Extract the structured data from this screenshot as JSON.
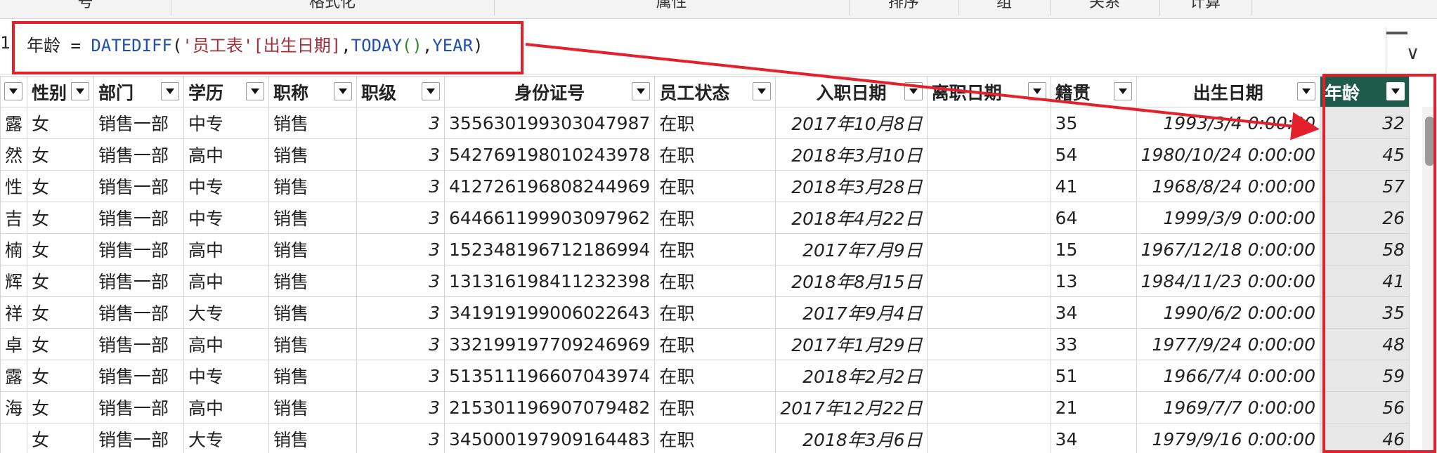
{
  "ribbon": {
    "cells": [
      "号",
      "格式化",
      "属性",
      "排序",
      "组",
      "关系",
      "计算"
    ]
  },
  "formula": {
    "line_number": "1",
    "column_name": "年龄",
    "equals": " = ",
    "fn_datediff": "DATEDIFF",
    "open_paren": "(",
    "table_ref": "'员工表'",
    "col_ref": "[出生日期]",
    "comma1": ",",
    "fn_today": "TODAY",
    "today_parens": "()",
    "comma2": ",",
    "fn_year": "YEAR",
    "close_paren": ")"
  },
  "table": {
    "headers": [
      "",
      "性别",
      "部门",
      "学历",
      "职称",
      "职级",
      "身份证号",
      "员工状态",
      "入职日期",
      "离职日期",
      "籍贯",
      "出生日期",
      "年龄"
    ],
    "rows": [
      [
        "露",
        "女",
        "销售一部",
        "中专",
        "销售",
        "3",
        "355630199303047987",
        "在职",
        "2017年10月8日",
        "",
        "35",
        "1993/3/4 0:00:00",
        "32"
      ],
      [
        "然",
        "女",
        "销售一部",
        "高中",
        "销售",
        "3",
        "542769198010243978",
        "在职",
        "2018年3月10日",
        "",
        "54",
        "1980/10/24 0:00:00",
        "45"
      ],
      [
        "性",
        "女",
        "销售一部",
        "中专",
        "销售",
        "3",
        "412726196808244969",
        "在职",
        "2018年3月28日",
        "",
        "41",
        "1968/8/24 0:00:00",
        "57"
      ],
      [
        "吉",
        "女",
        "销售一部",
        "中专",
        "销售",
        "3",
        "644661199903097962",
        "在职",
        "2018年4月22日",
        "",
        "64",
        "1999/3/9 0:00:00",
        "26"
      ],
      [
        "楠",
        "女",
        "销售一部",
        "高中",
        "销售",
        "3",
        "152348196712186994",
        "在职",
        "2017年7月9日",
        "",
        "15",
        "1967/12/18 0:00:00",
        "58"
      ],
      [
        "辉",
        "女",
        "销售一部",
        "高中",
        "销售",
        "3",
        "131316198411232398",
        "在职",
        "2018年8月15日",
        "",
        "13",
        "1984/11/23 0:00:00",
        "41"
      ],
      [
        "祥",
        "女",
        "销售一部",
        "大专",
        "销售",
        "3",
        "341919199006022643",
        "在职",
        "2017年9月4日",
        "",
        "34",
        "1990/6/2 0:00:00",
        "35"
      ],
      [
        "卓",
        "女",
        "销售一部",
        "高中",
        "销售",
        "3",
        "332199197709246969",
        "在职",
        "2017年1月29日",
        "",
        "33",
        "1977/9/24 0:00:00",
        "48"
      ],
      [
        "露",
        "女",
        "销售一部",
        "中专",
        "销售",
        "3",
        "513511196607043974",
        "在职",
        "2018年2月2日",
        "",
        "51",
        "1966/7/4 0:00:00",
        "59"
      ],
      [
        "海",
        "女",
        "销售一部",
        "高中",
        "销售",
        "3",
        "215301196907079482",
        "在职",
        "2017年12月22日",
        "",
        "21",
        "1969/7/7 0:00:00",
        "56"
      ],
      [
        "",
        "女",
        "销售一部",
        "大专",
        "销售",
        "3",
        "345000197909164483",
        "在职",
        "2018年3月6日",
        "",
        "34",
        "1979/9/16 0:00:00",
        "46"
      ]
    ]
  },
  "colors": {
    "highlight": "#e3202b",
    "selected_header": "#1e5b4b",
    "function_blue": "#1f4fb0"
  }
}
